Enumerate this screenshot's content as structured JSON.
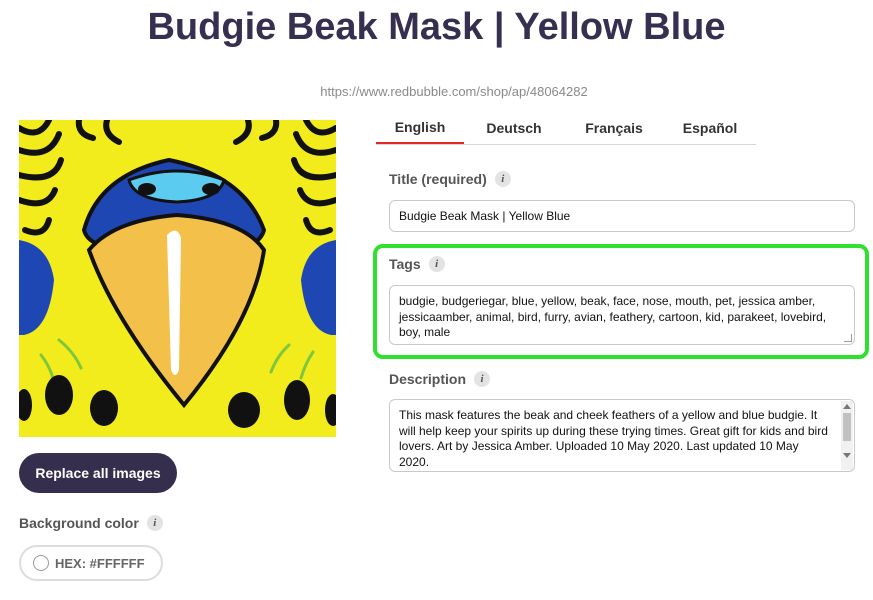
{
  "page": {
    "title": "Budgie Beak Mask | Yellow Blue",
    "url": "https://www.redbubble.com/shop/ap/48064282"
  },
  "image_panel": {
    "colors": {
      "background": "#f2ec1d",
      "feather_blue": "#1f47b3",
      "cere_blue": "#5ccbf0",
      "beak": "#f3c14a",
      "spots": "#111111"
    }
  },
  "controls": {
    "replace_label": "Replace all images",
    "background_color_label": "Background color",
    "hex_value": "HEX: #FFFFFF"
  },
  "tabs": [
    {
      "label": "English",
      "active": true
    },
    {
      "label": "Deutsch",
      "active": false
    },
    {
      "label": "Français",
      "active": false
    },
    {
      "label": "Español",
      "active": false
    }
  ],
  "form": {
    "title_label": "Title (required)",
    "title_value": "Budgie Beak Mask | Yellow Blue",
    "tags_label": "Tags",
    "tags_value": "budgie, budgeriegar, blue, yellow, beak, face, nose, mouth, pet, jessica amber, jessicaamber, animal, bird, furry, avian, feathery, cartoon, kid, parakeet, lovebird, boy, male",
    "description_label": "Description",
    "description_value": "This mask features the beak and cheek feathers of a yellow and blue budgie. It will help keep your spirits up during these trying times. Great gift for kids and bird lovers. Art by Jessica Amber. Uploaded 10 May 2020. Last updated 10 May 2020."
  },
  "colors": {
    "title_color": "#362f4f",
    "button_bg": "#352e4d",
    "active_tab_underline": "#e5242e",
    "highlight": "#2fe02f"
  }
}
